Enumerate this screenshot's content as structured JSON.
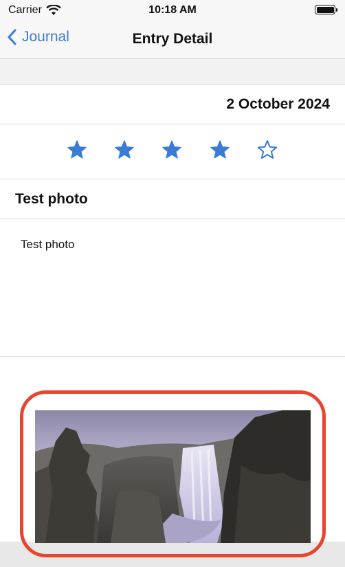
{
  "status_bar": {
    "carrier": "Carrier",
    "time": "10:18 AM",
    "wifi_icon": "wifi-icon",
    "battery_icon": "battery-icon",
    "battery_level": 1.0
  },
  "nav": {
    "back_label": "Journal",
    "back_icon": "chevron-left-icon",
    "title": "Entry Detail"
  },
  "entry": {
    "date": "2 October 2024",
    "rating": 4,
    "rating_max": 5,
    "title": "Test photo",
    "body": "Test photo",
    "photo": "waterfall-photo"
  },
  "colors": {
    "accent": "#3a7bd5",
    "highlight": "#e8452f"
  }
}
